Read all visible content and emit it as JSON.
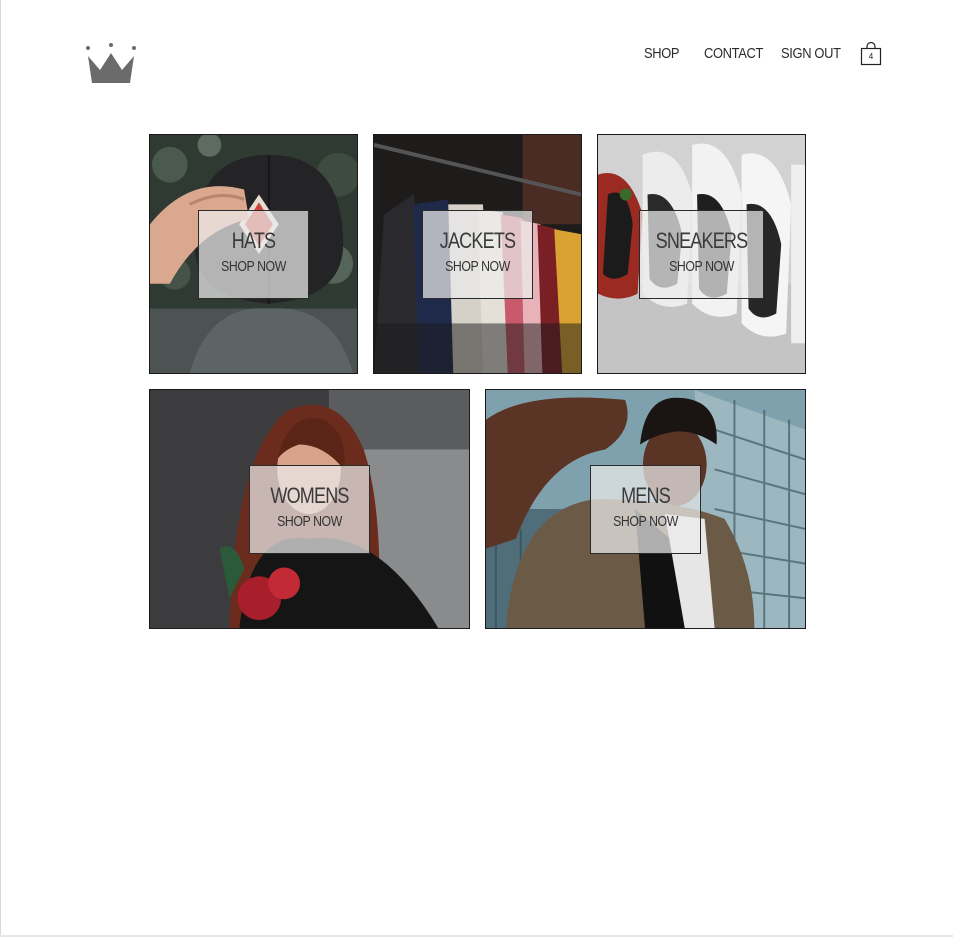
{
  "nav": {
    "links": [
      "SHOP",
      "CONTACT",
      "SIGN OUT"
    ],
    "cart_count": "4"
  },
  "categories": [
    {
      "title": "HATS",
      "cta": "SHOP NOW"
    },
    {
      "title": "JACKETS",
      "cta": "SHOP NOW"
    },
    {
      "title": "SNEAKERS",
      "cta": "SHOP NOW"
    },
    {
      "title": "WOMENS",
      "cta": "SHOP NOW"
    },
    {
      "title": "MENS",
      "cta": "SHOP NOW"
    }
  ],
  "icons": {
    "logo": "crown-icon",
    "cart": "shopping-bag-icon"
  },
  "colors": {
    "text": "#2b2b2b",
    "border": "#1a1a1a",
    "logo": "#6b6b6b"
  }
}
